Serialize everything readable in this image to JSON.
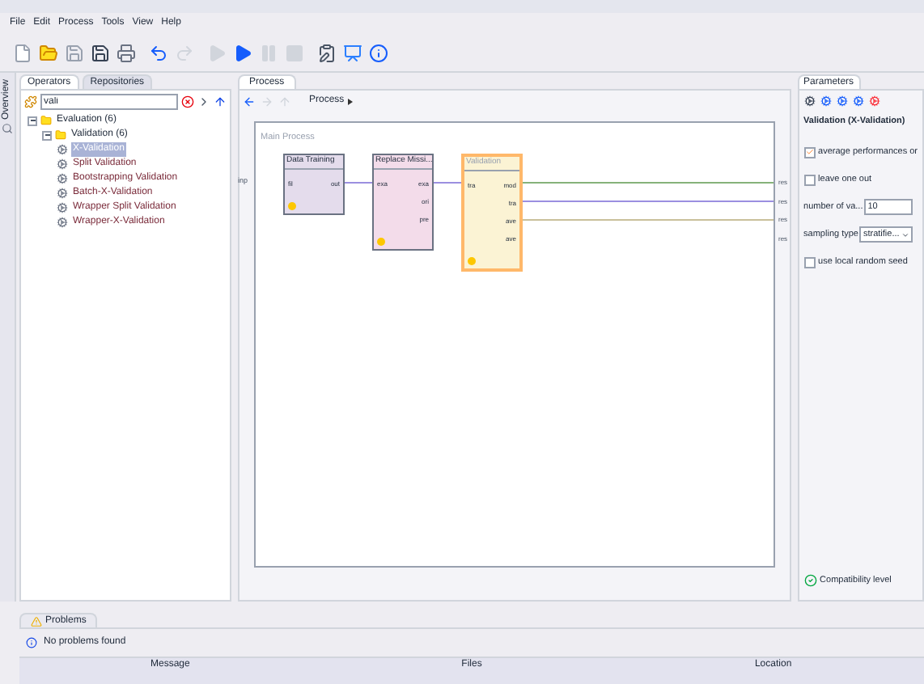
{
  "menu": [
    "File",
    "Edit",
    "Process",
    "Tools",
    "View",
    "Help"
  ],
  "side_tab": "Overview",
  "left_tabs": [
    {
      "label": "Operators",
      "selected": true
    },
    {
      "label": "Repositories",
      "selected": false
    }
  ],
  "search": {
    "value": "vali"
  },
  "tree": [
    {
      "label": "Evaluation (6)",
      "expanded": true,
      "children": [
        {
          "label": "Validation (6)",
          "expanded": true,
          "children": [
            {
              "label": "X-Validation",
              "selected": true
            },
            {
              "label": "Split Validation",
              "selected": false
            },
            {
              "label": "Bootstrapping Validation",
              "selected": false
            },
            {
              "label": "Batch-X-Validation",
              "selected": false
            },
            {
              "label": "Wrapper Split Validation",
              "selected": false
            },
            {
              "label": "Wrapper-X-Validation",
              "selected": false
            }
          ]
        }
      ]
    }
  ],
  "process": {
    "tab": "Process",
    "breadcrumb": "Process",
    "canvas_title": "Main Process",
    "input_port": "inp",
    "nodes": [
      {
        "title": "Data Training",
        "selected": false,
        "color": "#e4dcec",
        "in_ports": [
          "fil"
        ],
        "out_ports": [
          "out"
        ]
      },
      {
        "title": "Replace Missi...",
        "selected": false,
        "color": "#f3dcea",
        "in_ports": [
          "exa"
        ],
        "out_ports": [
          "exa",
          "ori",
          "pre"
        ]
      },
      {
        "title": "Validation",
        "selected": true,
        "color": "#fbf3d4",
        "in_ports": [
          "tra"
        ],
        "out_ports": [
          "mod",
          "tra",
          "ave",
          "ave"
        ]
      }
    ],
    "output_ports": [
      "res",
      "res",
      "res",
      "res"
    ]
  },
  "parameters": {
    "tab": "Parameters",
    "header": "Validation (X-Validation)",
    "items": [
      {
        "kind": "checkbox",
        "label": "average performances or",
        "checked": true
      },
      {
        "kind": "checkbox",
        "label": "leave one out",
        "checked": false
      },
      {
        "kind": "field",
        "label": "number of va...",
        "value": "10"
      },
      {
        "kind": "dropdown",
        "label": "sampling type",
        "value": "stratifie..."
      },
      {
        "kind": "checkbox",
        "label": "use local random seed",
        "checked": false
      }
    ],
    "compatibility": "Compatibility level"
  },
  "problems": {
    "tab": "Problems",
    "message": "No problems found",
    "columns": [
      "Message",
      "Files",
      "Location"
    ]
  }
}
